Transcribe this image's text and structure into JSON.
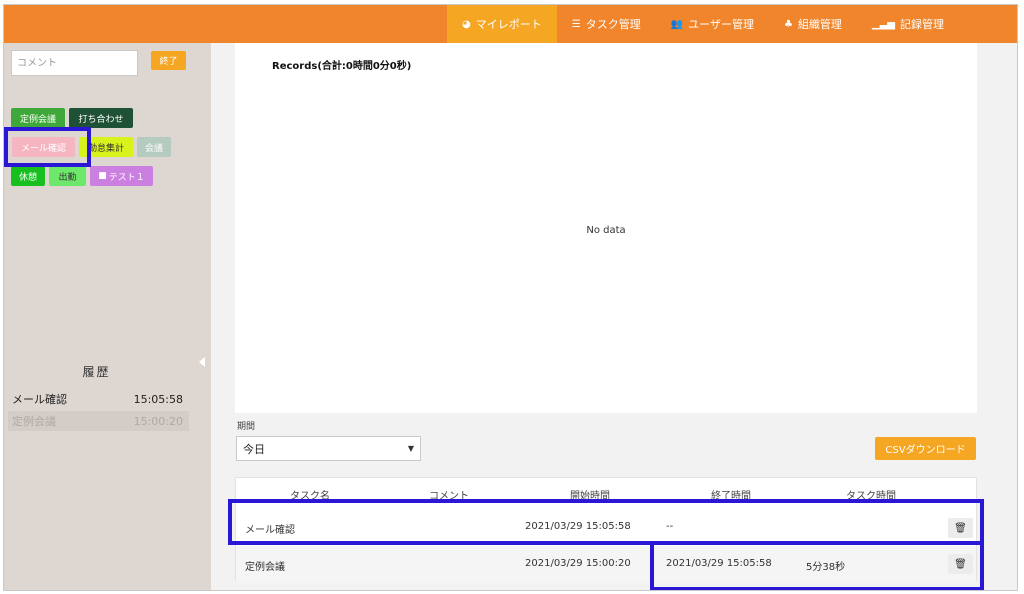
{
  "nav": {
    "items": [
      {
        "label": "マイレポート",
        "icon": "pie-chart-icon",
        "glyph": "◕",
        "active": true
      },
      {
        "label": "タスク管理",
        "icon": "list-icon",
        "glyph": "☰",
        "active": false
      },
      {
        "label": "ユーザー管理",
        "icon": "users-icon",
        "glyph": "👥",
        "active": false
      },
      {
        "label": "組織管理",
        "icon": "sitemap-icon",
        "glyph": "♣",
        "active": false
      },
      {
        "label": "記録管理",
        "icon": "bar-chart-icon",
        "glyph": "▁▃▅",
        "active": false
      }
    ]
  },
  "sidebar": {
    "comment_placeholder": "コメント",
    "end_label": "終了",
    "tags": [
      {
        "label": "定例会議",
        "bg": "#3fa83a",
        "fg": "#ffffff"
      },
      {
        "label": "打ち合わせ",
        "bg": "#1f5136",
        "fg": "#ffffff"
      },
      {
        "label": "メール確認",
        "bg": "#f5b6c2",
        "fg": "#ffffff"
      },
      {
        "label": "勤怠集計",
        "bg": "#d8f21b",
        "fg": "#333333"
      },
      {
        "label": "会議",
        "bg": "#b6cbbf",
        "fg": "#ffffff"
      },
      {
        "label": "休憩",
        "bg": "#17c01e",
        "fg": "#ffffff"
      },
      {
        "label": "出勤",
        "bg": "#6ee86a",
        "fg": "#333333"
      },
      {
        "label": "テスト１",
        "bg": "#cb7fe0",
        "fg": "#ffffff",
        "folder": true
      }
    ],
    "history_title": "履歴",
    "history": [
      {
        "name": "メール確認",
        "time": "15:05:58"
      },
      {
        "name": "定例会議",
        "time": "15:00:20"
      }
    ]
  },
  "chart": {
    "title": "Records(合計:0時間0分0秒)",
    "empty_text": "No data"
  },
  "filters": {
    "period_label": "期間",
    "period_value": "今日",
    "csv_label": "CSVダウンロード"
  },
  "table": {
    "headers": [
      "タスク名",
      "コメント",
      "開始時間",
      "終了時間",
      "タスク時間"
    ],
    "rows": [
      {
        "task": "メール確認",
        "comment": "",
        "start": "2021/03/29 15:05:58",
        "end": "--",
        "duration": ""
      },
      {
        "task": "定例会議",
        "comment": "",
        "start": "2021/03/29 15:00:20",
        "end": "2021/03/29 15:05:58",
        "duration": "5分38秒"
      }
    ]
  },
  "colors": {
    "brand_orange": "#f0852b",
    "accent_orange": "#f5a623",
    "highlight": "#2a17d6"
  }
}
